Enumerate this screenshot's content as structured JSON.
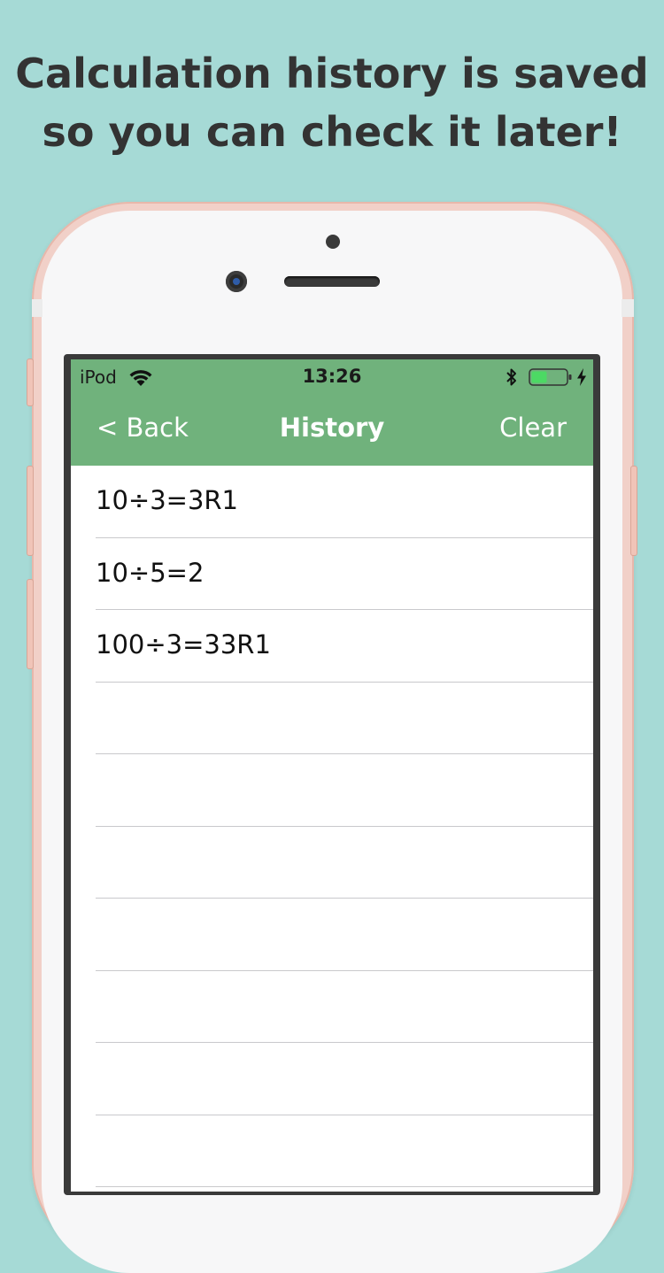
{
  "promo": {
    "line1": "Calculation history is saved",
    "line2": "so you can check it later!"
  },
  "status_bar": {
    "carrier": "iPod",
    "time": "13:26"
  },
  "nav": {
    "back_label": "< Back",
    "title": "History",
    "clear_label": "Clear"
  },
  "history": {
    "items": [
      "10÷3=3R1",
      "10÷5=2",
      "100÷3=33R1",
      "",
      "",
      "",
      "",
      "",
      "",
      "",
      ""
    ]
  },
  "colors": {
    "background": "#a6dad6",
    "header_green": "#70b27c",
    "battery_fill": "#4cd964",
    "phone_rose_gold": "#f1d0c8"
  },
  "icons": {
    "wifi": "wifi-icon",
    "bluetooth": "bluetooth-icon",
    "battery": "battery-icon",
    "charging": "charging-bolt-icon"
  }
}
